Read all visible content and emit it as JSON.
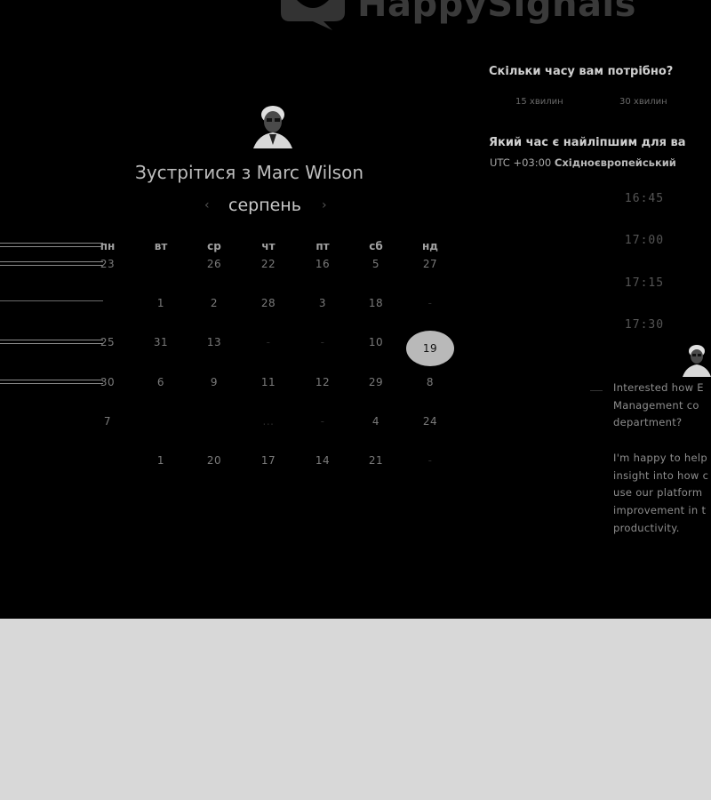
{
  "brand": {
    "name": "HappySignals"
  },
  "meeting": {
    "title": "Зустрітися з Marc Wilson"
  },
  "calendar": {
    "month": "серпень",
    "weekdays": [
      "пн",
      "вт",
      "ср",
      "чт",
      "пт",
      "сб",
      "нд"
    ],
    "rows": [
      [
        "23",
        "",
        "26",
        "22",
        "16",
        "5",
        "27"
      ],
      [
        "",
        "1",
        "2",
        "28",
        "3",
        "18",
        "-"
      ],
      [
        "25",
        "31",
        "13",
        "-",
        "-",
        "10",
        "19"
      ],
      [
        "30",
        "6",
        "9",
        "11",
        "12",
        "29",
        "8"
      ],
      [
        "7",
        "",
        "",
        "...",
        "-",
        "4",
        "24"
      ],
      [
        "",
        "1",
        "20",
        "17",
        "14",
        "21",
        "-"
      ]
    ],
    "selected": "19"
  },
  "duration": {
    "question": "Скільки часу вам потрібно?",
    "options": [
      "15 хвилин",
      "30 хвилин"
    ]
  },
  "time": {
    "question": "Який час є найліпшим для ва",
    "tz_offset": "UTC +03:00",
    "tz_name": "Східноєвропейський",
    "slots": [
      "16:45",
      "17:00",
      "17:15",
      "17:30"
    ]
  },
  "bio": {
    "p1": "Interested how E\nManagement co\ndepartment?",
    "p2": "I'm happy to help\ninsight into how c\nuse our platform\nimprovement in t\nproductivity."
  }
}
